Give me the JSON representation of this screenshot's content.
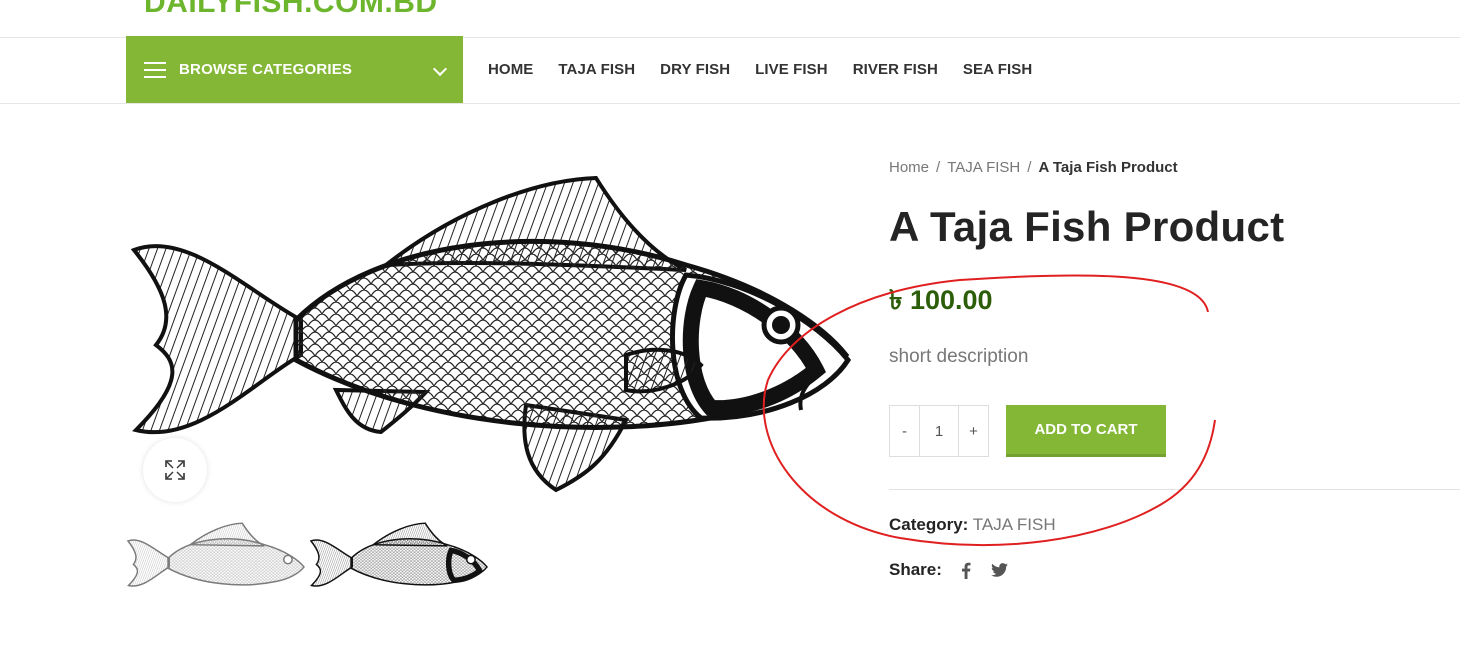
{
  "site": {
    "logo_text": "DAILYFISH.COM.BD"
  },
  "nav": {
    "browse_label": "BROWSE CATEGORIES",
    "menu": [
      "HOME",
      "TAJA FISH",
      "DRY FISH",
      "LIVE FISH",
      "RIVER FISH",
      "SEA FISH"
    ]
  },
  "breadcrumb": {
    "home": "Home",
    "category": "TAJA FISH",
    "current": "A Taja Fish Product",
    "sep": "/"
  },
  "product": {
    "title": "A Taja Fish Product",
    "price": "৳ 100.00",
    "short_description": "short description",
    "quantity": "1",
    "minus": "-",
    "plus": "+",
    "add_to_cart": "ADD TO CART",
    "category_label": "Category:",
    "category_value": "TAJA FISH",
    "share_label": "Share:"
  },
  "icons": {
    "menu": "hamburger-icon",
    "dropdown": "chevron-down-icon",
    "zoom": "expand-icon",
    "facebook": "facebook-icon",
    "twitter": "twitter-icon"
  },
  "colors": {
    "accent": "#83b735",
    "logo": "#6cb52d",
    "price": "#2c5e0a",
    "annotation": "#e02020"
  }
}
